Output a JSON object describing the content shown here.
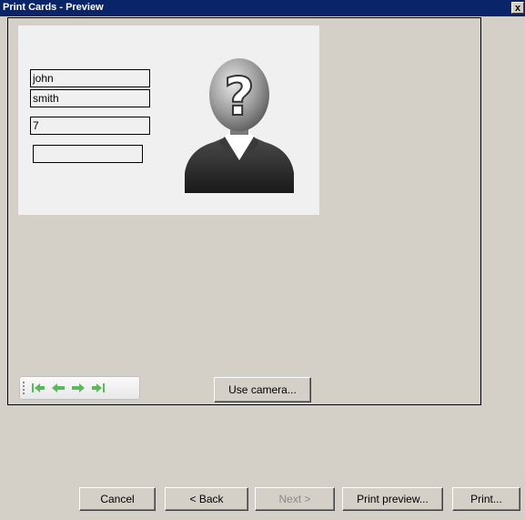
{
  "window": {
    "title": "Print Cards - Preview",
    "close_label": "x"
  },
  "card": {
    "fields": [
      {
        "value": "john"
      },
      {
        "value": "smith"
      },
      {
        "value": "7"
      },
      {
        "value": ""
      }
    ],
    "photo_icon": "unknown-person-icon"
  },
  "navigation": {
    "icons": [
      "first-record-icon",
      "previous-record-icon",
      "next-record-icon",
      "last-record-icon"
    ],
    "accent": "#5cb85c"
  },
  "buttons": {
    "use_camera": "Use camera...",
    "cancel": "Cancel",
    "back": "< Back",
    "next": "Next >",
    "print_preview": "Print preview...",
    "print": "Print..."
  }
}
